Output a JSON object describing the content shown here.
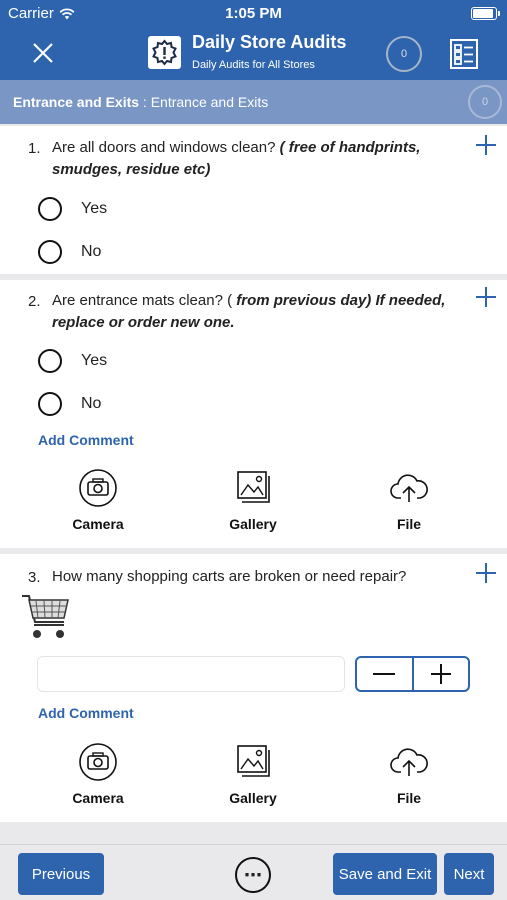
{
  "status_bar": {
    "carrier": "Carrier",
    "time": "1:05 PM",
    "battery_level": 0.95
  },
  "header": {
    "title": "Daily Store Audits",
    "subtitle": "Daily Audits for All Stores",
    "count": "0"
  },
  "section": {
    "name": "Entrance and Exits",
    "separator": " : ",
    "detail": "Entrance and Exits",
    "count": "0"
  },
  "questions": [
    {
      "number": "1.",
      "text": "Are all doors and windows clean? ",
      "emphasis": "( free of handprints, smudges, residue etc)",
      "options": [
        "Yes",
        "No"
      ]
    },
    {
      "number": "2.",
      "text": "Are entrance mats clean? ( ",
      "emphasis": "from previous day) If needed, replace or order new one.",
      "options": [
        "Yes",
        "No"
      ],
      "add_comment": "Add Comment",
      "attachments": [
        "Camera",
        "Gallery",
        "File"
      ]
    },
    {
      "number": "3.",
      "text": "How many shopping carts are broken or need repair?",
      "input_value": "",
      "add_comment": "Add Comment",
      "attachments": [
        "Camera",
        "Gallery",
        "File"
      ]
    }
  ],
  "footer": {
    "previous": "Previous",
    "save_exit": "Save and Exit",
    "next": "Next"
  },
  "colors": {
    "primary": "#2e64ae",
    "section_bar": "#7996c4",
    "background": "#e9e9ec"
  }
}
